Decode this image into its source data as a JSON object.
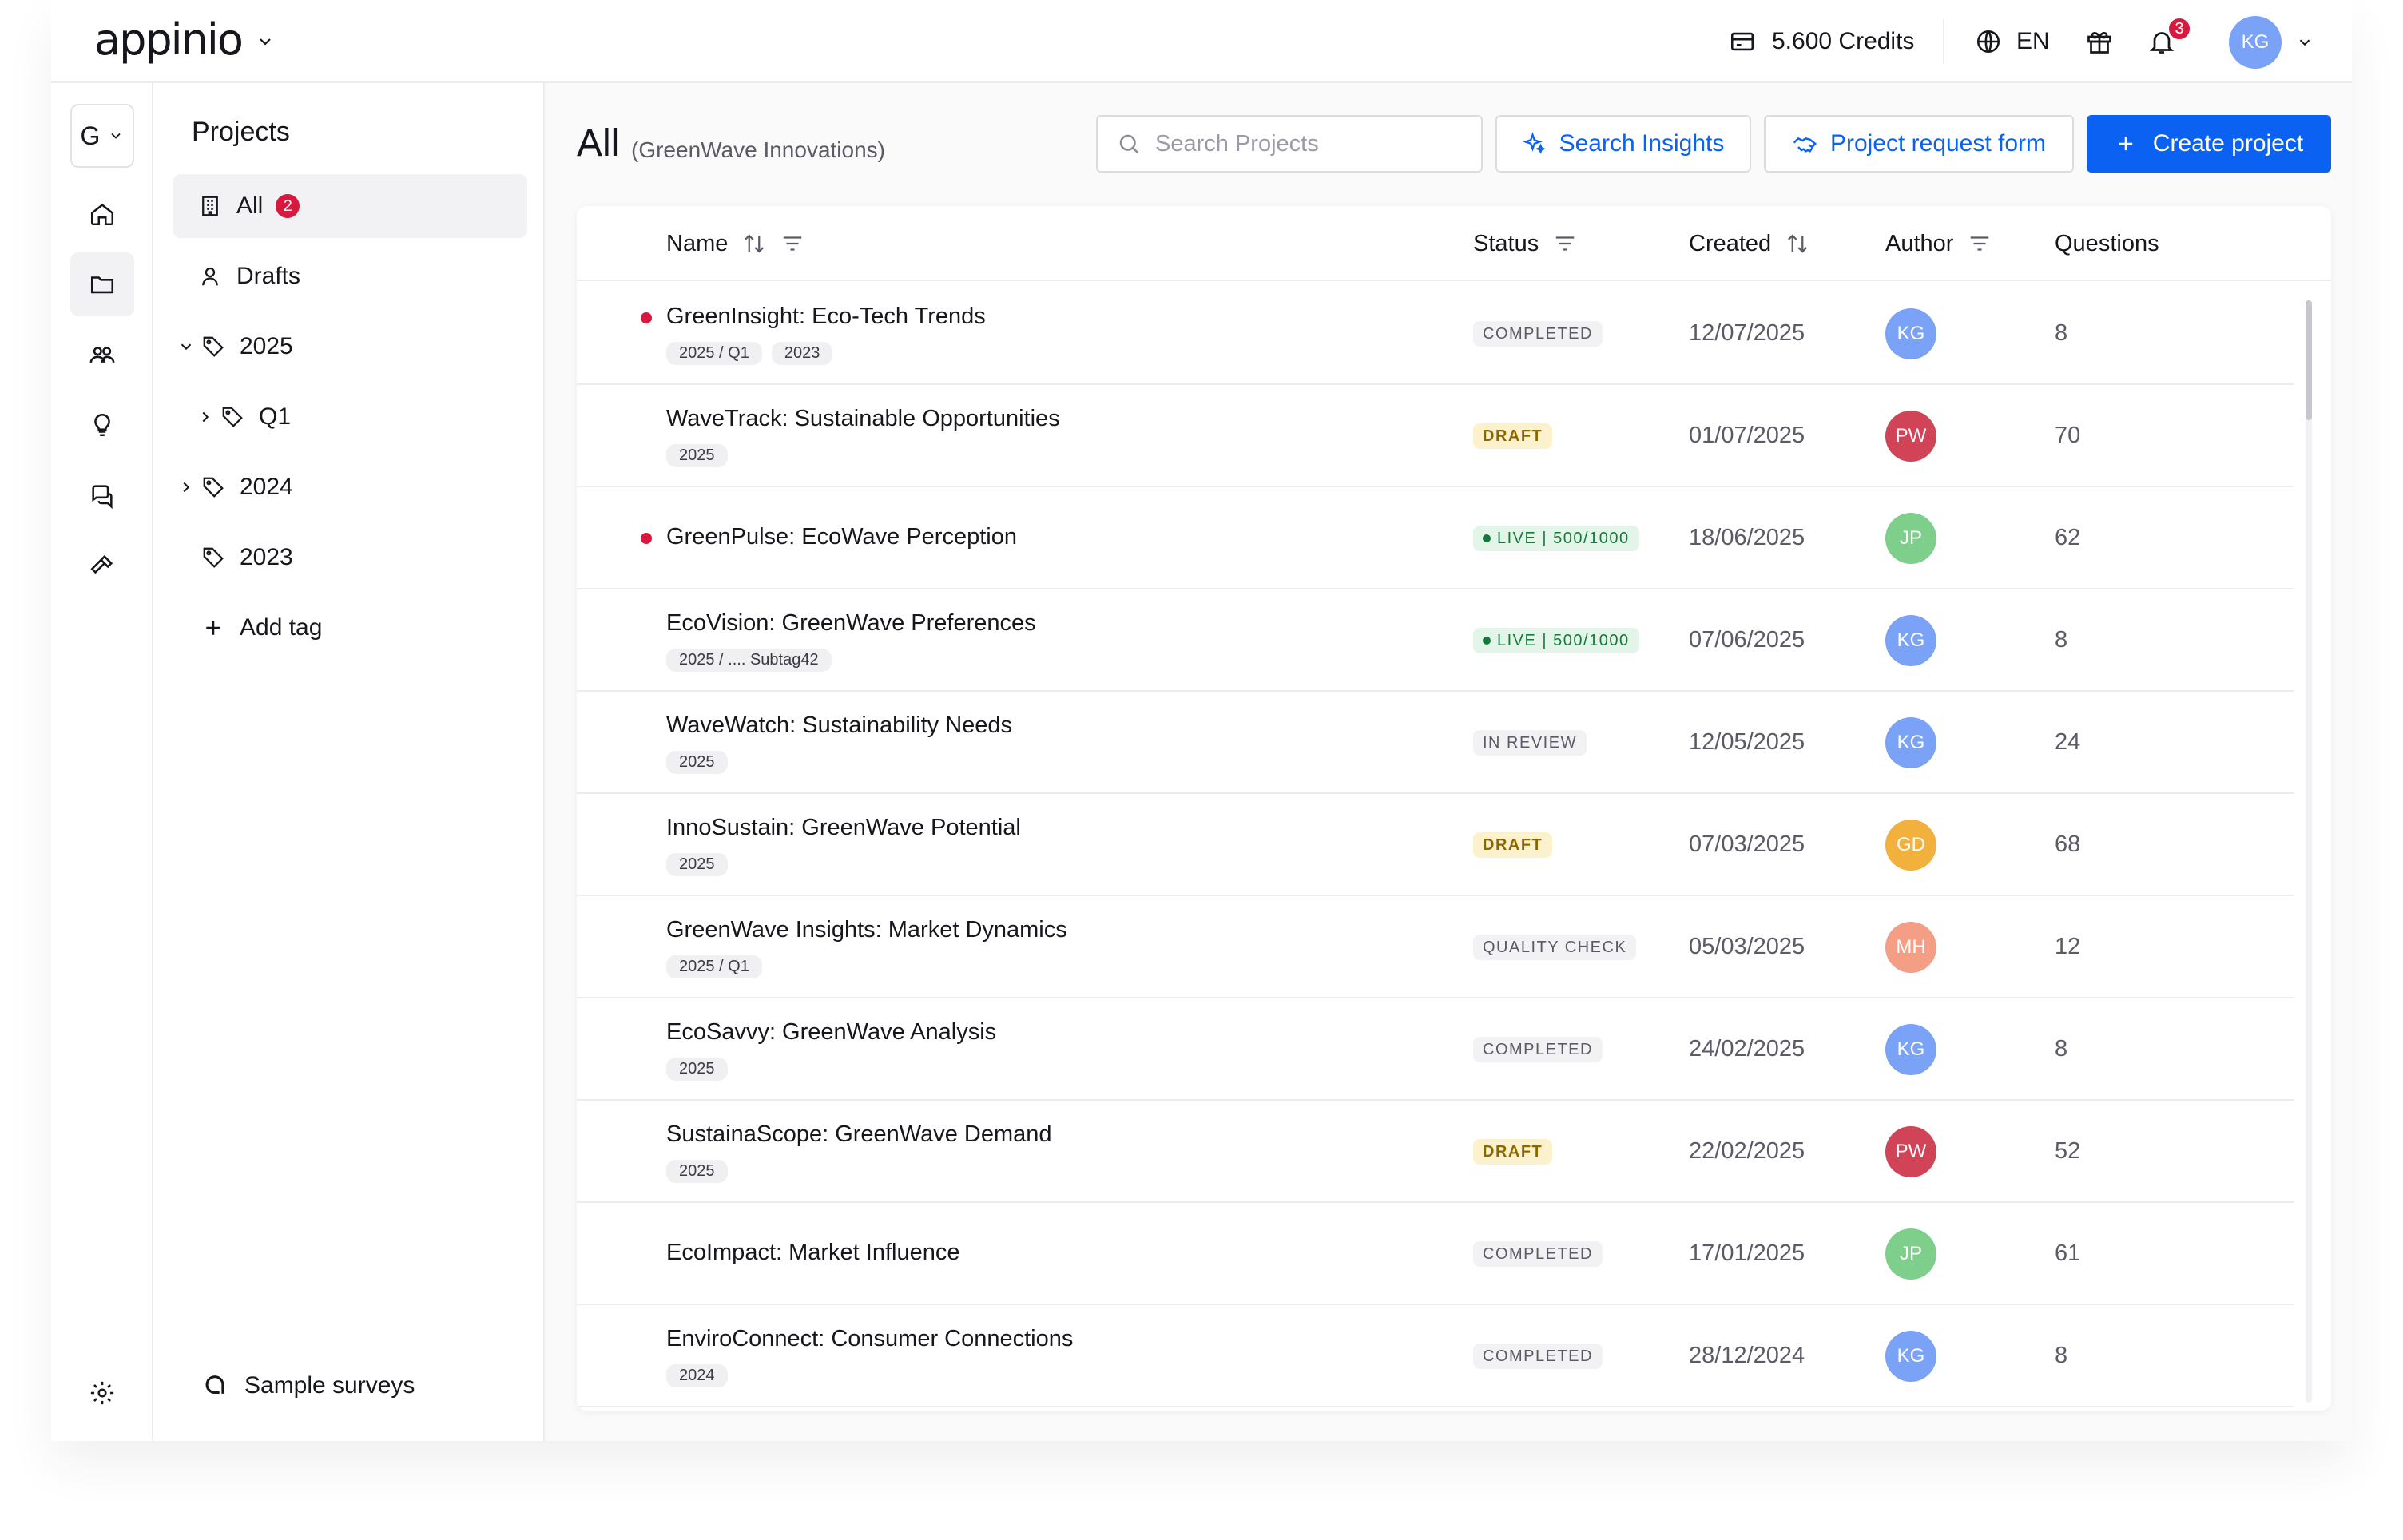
{
  "header": {
    "logo": "appinio",
    "credits": "5.600 Credits",
    "language": "EN",
    "notifications_count": "3",
    "user_initials": "KG"
  },
  "rail": {
    "workspace_letter": "G",
    "items": [
      {
        "name": "home",
        "icon": "home-icon"
      },
      {
        "name": "projects",
        "icon": "folder-icon",
        "active": true
      },
      {
        "name": "audiences",
        "icon": "users-icon"
      },
      {
        "name": "insights",
        "icon": "lightbulb-icon"
      },
      {
        "name": "chat",
        "icon": "chat-icon"
      },
      {
        "name": "tools",
        "icon": "hammer-icon"
      }
    ],
    "settings_icon": "gear-icon"
  },
  "folders": {
    "title": "Projects",
    "items": [
      {
        "label": "All",
        "count": "2"
      },
      {
        "label": "Drafts"
      },
      {
        "label": "2025"
      },
      {
        "label": "Q1"
      },
      {
        "label": "2024"
      },
      {
        "label": "2023"
      },
      {
        "label": "Add tag"
      }
    ],
    "sample_surveys": "Sample surveys"
  },
  "main": {
    "title": "All",
    "subtitle": "(GreenWave Innovations)",
    "search_placeholder": "Search Projects",
    "search_insights_label": "Search Insights",
    "request_form_label": "Project request form",
    "create_label": "Create project"
  },
  "table": {
    "columns": {
      "name": "Name",
      "status": "Status",
      "created": "Created",
      "author": "Author",
      "questions": "Questions"
    },
    "rows": [
      {
        "name": "GreenInsight: Eco-Tech Trends",
        "dot": true,
        "tags": [
          "2025 / Q1",
          "2023"
        ],
        "status": "COMPLETED",
        "status_type": "completed",
        "created": "12/07/2025",
        "author": "KG",
        "author_color": "#7aa3f7",
        "questions": "8"
      },
      {
        "name": "WaveTrack: Sustainable Opportunities",
        "dot": false,
        "tags": [
          "2025"
        ],
        "status": "DRAFT",
        "status_type": "draft",
        "created": "01/07/2025",
        "author": "PW",
        "author_color": "#d14458",
        "questions": "70"
      },
      {
        "name": "GreenPulse: EcoWave Perception",
        "dot": true,
        "tags": [],
        "status": "LIVE | 500/1000",
        "status_type": "live",
        "created": "18/06/2025",
        "author": "JP",
        "author_color": "#7fcf8c",
        "questions": "62"
      },
      {
        "name": "EcoVision: GreenWave Preferences",
        "dot": false,
        "tags": [
          "2025   / .... Subtag42"
        ],
        "status": "LIVE | 500/1000",
        "status_type": "live",
        "created": "07/06/2025",
        "author": "KG",
        "author_color": "#7aa3f7",
        "questions": "8"
      },
      {
        "name": "WaveWatch: Sustainability Needs",
        "dot": false,
        "tags": [
          "2025"
        ],
        "status": "IN REVIEW",
        "status_type": "review",
        "created": "12/05/2025",
        "author": "KG",
        "author_color": "#7aa3f7",
        "questions": "24"
      },
      {
        "name": "InnoSustain: GreenWave Potential",
        "dot": false,
        "tags": [
          "2025"
        ],
        "status": "DRAFT",
        "status_type": "draft",
        "created": "07/03/2025",
        "author": "GD",
        "author_color": "#f2b13c",
        "questions": "68"
      },
      {
        "name": "GreenWave Insights: Market Dynamics",
        "dot": false,
        "tags": [
          "2025 / Q1"
        ],
        "status": "QUALITY CHECK",
        "status_type": "quality",
        "created": "05/03/2025",
        "author": "MH",
        "author_color": "#f59e86",
        "questions": "12"
      },
      {
        "name": "EcoSavvy: GreenWave Analysis",
        "dot": false,
        "tags": [
          "2025"
        ],
        "status": "COMPLETED",
        "status_type": "completed",
        "created": "24/02/2025",
        "author": "KG",
        "author_color": "#7aa3f7",
        "questions": "8"
      },
      {
        "name": "SustainaScope: GreenWave Demand",
        "dot": false,
        "tags": [
          "2025"
        ],
        "status": "DRAFT",
        "status_type": "draft",
        "created": "22/02/2025",
        "author": "PW",
        "author_color": "#d14458",
        "questions": "52"
      },
      {
        "name": "EcoImpact: Market Influence",
        "dot": false,
        "tags": [],
        "status": "COMPLETED",
        "status_type": "completed",
        "created": "17/01/2025",
        "author": "JP",
        "author_color": "#7fcf8c",
        "questions": "61"
      },
      {
        "name": "EnviroConnect: Consumer Connections",
        "dot": false,
        "tags": [
          "2024"
        ],
        "status": "COMPLETED",
        "status_type": "completed",
        "created": "28/12/2024",
        "author": "KG",
        "author_color": "#7aa3f7",
        "questions": "8"
      }
    ]
  }
}
